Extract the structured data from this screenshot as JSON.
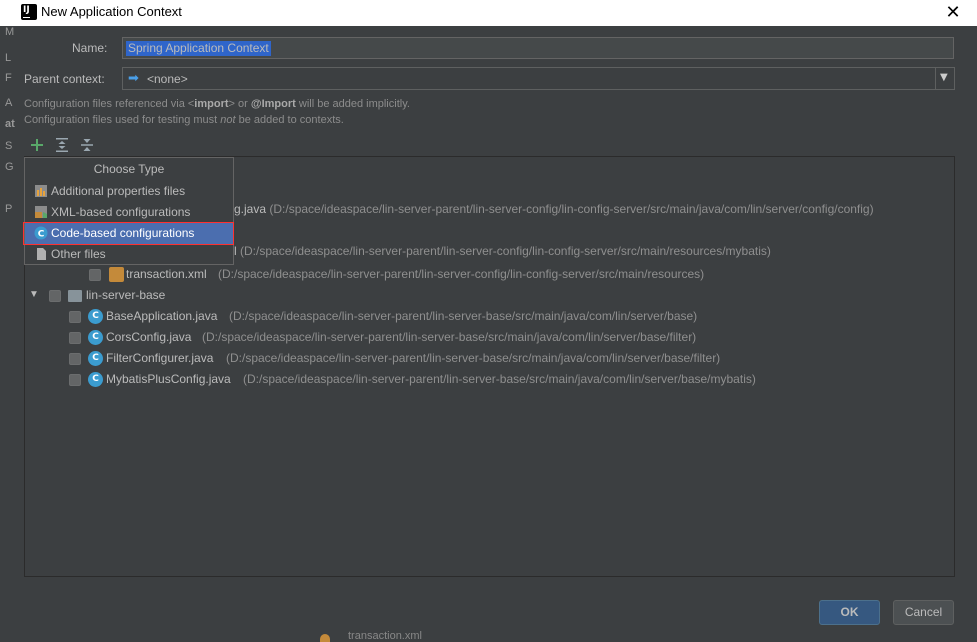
{
  "window": {
    "title": "New Application Context"
  },
  "parent_window_letters": [
    "M",
    "L",
    "F",
    "A",
    "at",
    "S",
    "G",
    "P"
  ],
  "form": {
    "name_label": "Name:",
    "name_value": "Spring Application Context",
    "parent_label": "Parent context:",
    "parent_value": "<none>"
  },
  "hints": {
    "line1_a": "Configuration files referenced via <",
    "line1_b": "import",
    "line1_c": "> or ",
    "line1_d": "@Import",
    "line1_e": " will be added implicitly.",
    "line2_a": "Configuration files used for testing must ",
    "line2_b": "not",
    "line2_c": " be added to contexts."
  },
  "popup": {
    "title": "Choose Type",
    "items": [
      {
        "label": "Additional properties files",
        "icon": "properties-file-icon",
        "selected": false
      },
      {
        "label": "XML-based configurations",
        "icon": "xml-config-icon",
        "selected": false
      },
      {
        "label": "Code-based configurations",
        "icon": "spring-class-icon",
        "selected": true
      },
      {
        "label": "Other files",
        "icon": "file-icon",
        "selected": false
      }
    ]
  },
  "tree": {
    "partial_rows": [
      {
        "name": "g.java",
        "path": "(D:/space/ideaspace/lin-server-parent/lin-server-config/lin-config-server/src/main/java/com/lin/server/config/config)"
      },
      {
        "name": "l",
        "path": "(D:/space/ideaspace/lin-server-parent/lin-server-config/lin-config-server/src/main/resources/mybatis)"
      }
    ],
    "transaction": {
      "name": "transaction.xml",
      "path": "(D:/space/ideaspace/lin-server-parent/lin-server-config/lin-config-server/src/main/resources)"
    },
    "module": {
      "name": "lin-server-base"
    },
    "files": [
      {
        "name": "BaseApplication.java",
        "path": "(D:/space/ideaspace/lin-server-parent/lin-server-base/src/main/java/com/lin/server/base)"
      },
      {
        "name": "CorsConfig.java",
        "path": "(D:/space/ideaspace/lin-server-parent/lin-server-base/src/main/java/com/lin/server/base/filter)"
      },
      {
        "name": "FilterConfigurer.java",
        "path": "(D:/space/ideaspace/lin-server-parent/lin-server-base/src/main/java/com/lin/server/base/filter)"
      },
      {
        "name": "MybatisPlusConfig.java",
        "path": "(D:/space/ideaspace/lin-server-parent/lin-server-base/src/main/java/com/lin/server/base/mybatis)"
      }
    ]
  },
  "buttons": {
    "ok": "OK",
    "cancel": "Cancel"
  },
  "background_text": "transaction.xml",
  "colors": {
    "accent": "#4b6eaf",
    "highlight_border": "#ff3030",
    "class_icon": "#3b9ccf"
  }
}
